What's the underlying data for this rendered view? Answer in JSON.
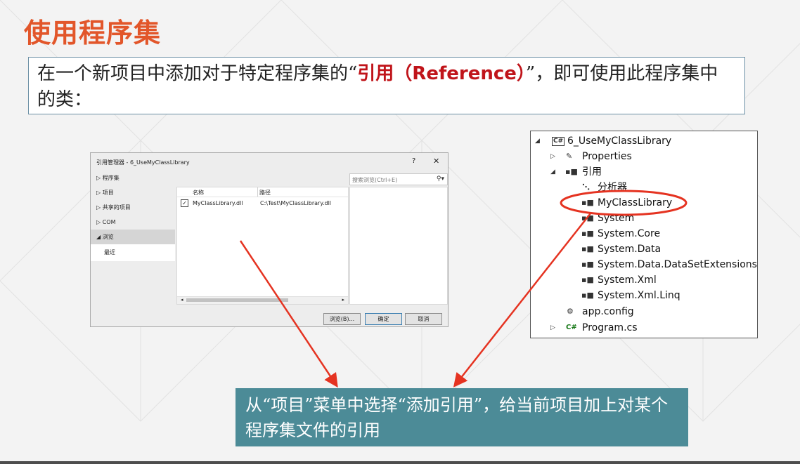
{
  "slide": {
    "title": "使用程序集",
    "intro_before": "在一个新项目中添加对于特定程序集的“",
    "intro_highlight": "引用（Reference）",
    "intro_after": "”，即可使用此程序集中的类：",
    "note": "从“项目”菜单中选择“添加引用”，给当前项目加上对某个程序集文件的引用"
  },
  "dialog": {
    "title": "引用管理器 - 6_UseMyClassLibrary",
    "help": "?",
    "close": "✕",
    "nav": [
      {
        "arrow": "▷",
        "label": "程序集"
      },
      {
        "arrow": "▷",
        "label": "项目"
      },
      {
        "arrow": "▷",
        "label": "共享的项目"
      },
      {
        "arrow": "▷",
        "label": "COM"
      },
      {
        "arrow": "◢",
        "label": "浏览"
      }
    ],
    "nav_sub": "最近",
    "search_placeholder": "搜索浏览(Ctrl+E)",
    "columns": {
      "name": "名称",
      "path": "路径"
    },
    "rows": [
      {
        "checked": "✓",
        "name": "MyClassLibrary.dll",
        "path": "C:\\Test\\MyClassLibrary.dll"
      }
    ],
    "buttons": {
      "browse": "浏览(B)...",
      "ok": "确定",
      "cancel": "取消"
    }
  },
  "tree": {
    "items": [
      {
        "expander": "◢",
        "icon": "C#",
        "label": "6_UseMyClassLibrary"
      },
      {
        "expander": "▷",
        "icon": "🔧",
        "label": "Properties"
      },
      {
        "expander": "◢",
        "icon": "▪■",
        "label": "引用"
      },
      {
        "expander": "",
        "icon": "⋱",
        "label": "分析器"
      },
      {
        "expander": "",
        "icon": "▪■",
        "label": "MyClassLibrary"
      },
      {
        "expander": "",
        "icon": "▪■",
        "label": "System"
      },
      {
        "expander": "",
        "icon": "▪■",
        "label": "System.Core"
      },
      {
        "expander": "",
        "icon": "▪■",
        "label": "System.Data"
      },
      {
        "expander": "",
        "icon": "▪■",
        "label": "System.Data.DataSetExtensions"
      },
      {
        "expander": "",
        "icon": "▪■",
        "label": "System.Xml"
      },
      {
        "expander": "",
        "icon": "▪■",
        "label": "System.Xml.Linq"
      },
      {
        "expander": "",
        "icon": "⚙",
        "label": "app.config"
      },
      {
        "expander": "▷",
        "icon": "C#",
        "label": "Program.cs"
      }
    ]
  },
  "colors": {
    "title": "#e2562a",
    "highlight": "#c0141a",
    "note_bg": "#4c8b97",
    "arrow": "#e53321"
  }
}
